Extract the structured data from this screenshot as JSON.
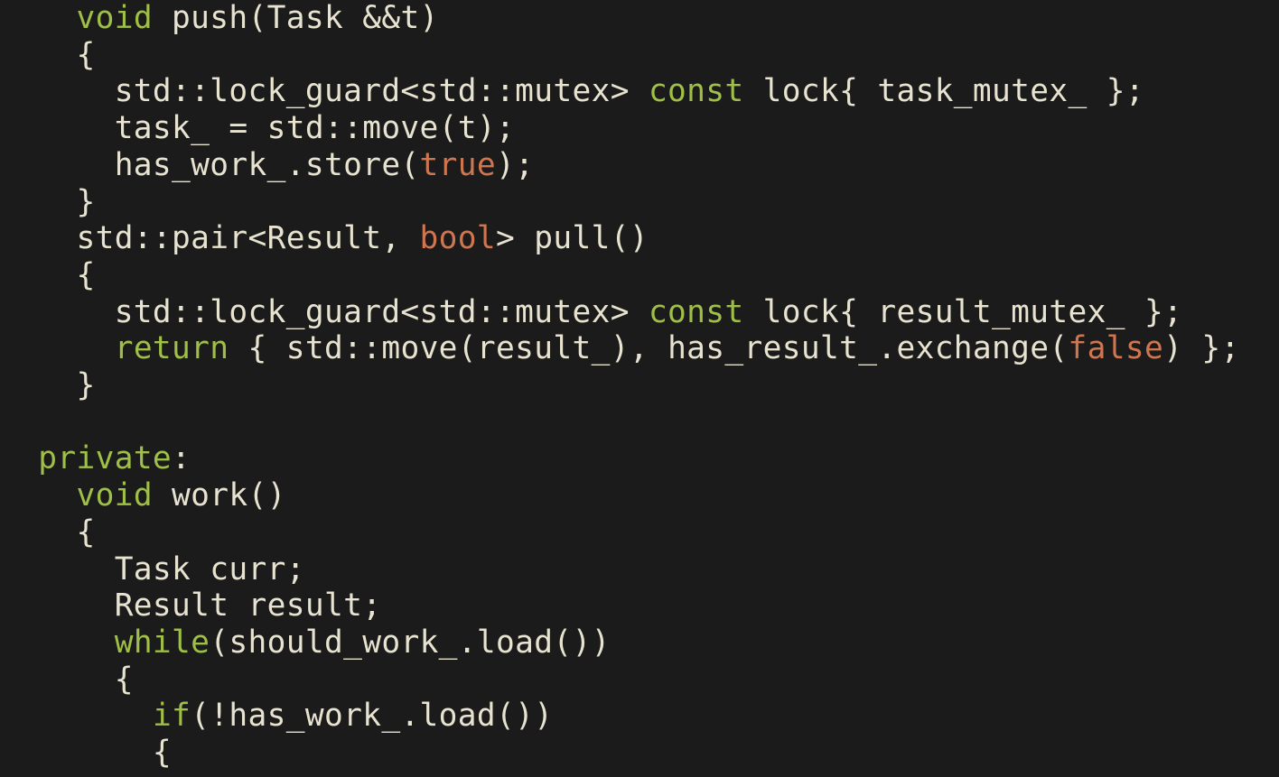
{
  "code": {
    "line01": {
      "a": "    ",
      "kw1": "void",
      "b": " push(Task &&t)"
    },
    "line02": {
      "a": "    {"
    },
    "line03": {
      "a": "      std::lock_guard<std::mutex> ",
      "kw1": "const",
      "b": " lock{ task_mutex_ };"
    },
    "line04": {
      "a": "      task_ = std::move(t);"
    },
    "line05": {
      "a": "      has_work_.store(",
      "bool1": "true",
      "b": ");"
    },
    "line06": {
      "a": "    }"
    },
    "line07": {
      "a": "    std::pair<Result, ",
      "bool1": "bool",
      "b": "> pull()"
    },
    "line08": {
      "a": "    {"
    },
    "line09": {
      "a": "      std::lock_guard<std::mutex> ",
      "kw1": "const",
      "b": " lock{ result_mutex_ };"
    },
    "line10": {
      "a": "      ",
      "kw1": "return",
      "b": " { std::move(result_), has_result_.exchange(",
      "bool1": "false",
      "c": ") };"
    },
    "line11": {
      "a": "    }"
    },
    "line12": {
      "a": ""
    },
    "line13": {
      "a": "  ",
      "kw1": "private",
      "b": ":"
    },
    "line14": {
      "a": "    ",
      "kw1": "void",
      "b": " work()"
    },
    "line15": {
      "a": "    {"
    },
    "line16": {
      "a": "      Task curr;"
    },
    "line17": {
      "a": "      Result result;"
    },
    "line18": {
      "a": "      ",
      "kw1": "while",
      "b": "(should_work_.load())"
    },
    "line19": {
      "a": "      {"
    },
    "line20": {
      "a": "        ",
      "kw1": "if",
      "b": "(!has_work_.load())"
    },
    "line21": {
      "a": "        {"
    }
  }
}
